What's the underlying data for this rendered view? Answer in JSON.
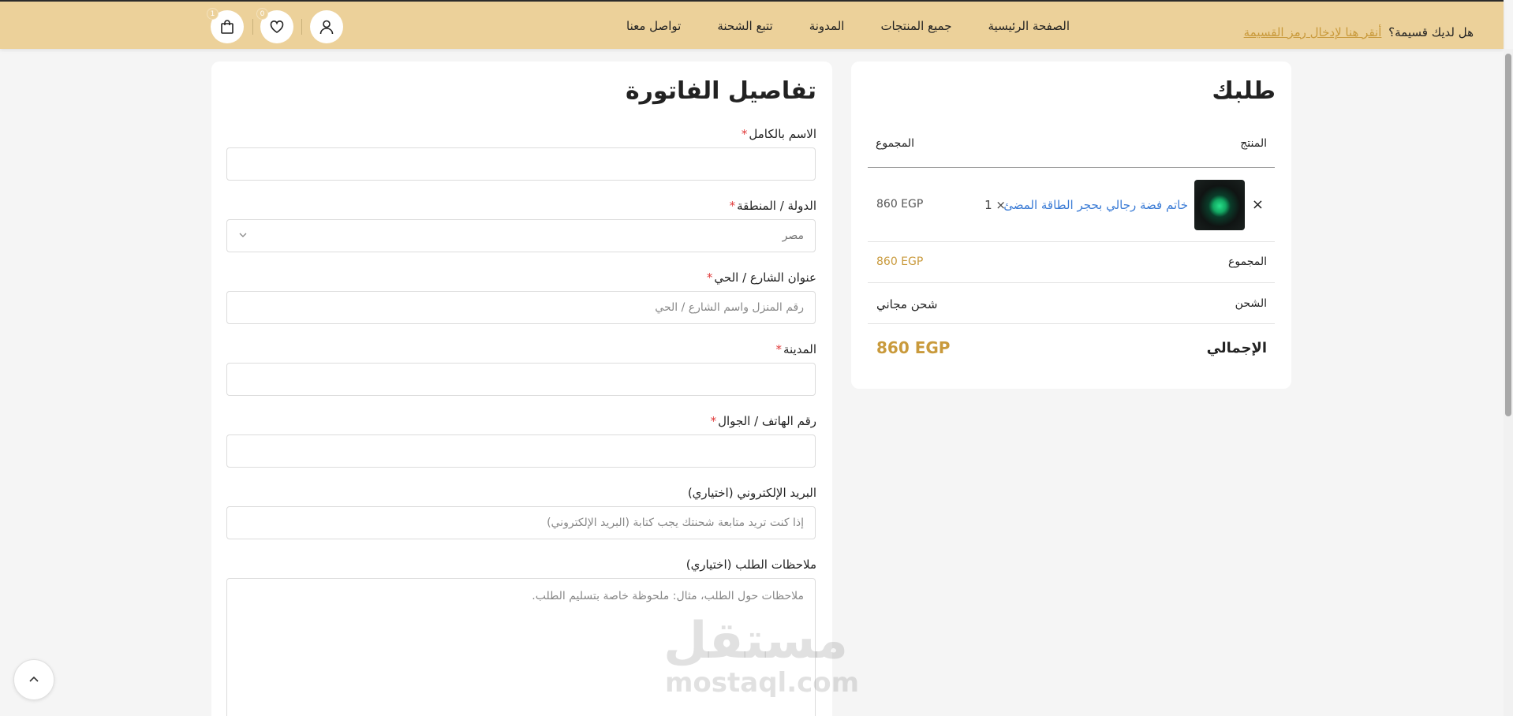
{
  "header": {
    "coupon_question": "هل لديك قسيمة؟",
    "coupon_link": "أنقر هنا لإدخال رمز القسيمة",
    "nav": [
      "الصفحة الرئيسية",
      "جميع المنتجات",
      "المدونة",
      "تتبع الشحنة",
      "تواصل معنا"
    ],
    "cart_count": "1",
    "wishlist_count": "0"
  },
  "order": {
    "title": "طلبك",
    "col_product": "المنتج",
    "col_total": "المجموع",
    "item": {
      "remove": "×",
      "name": "خاتم فضة رجالي بحجر الطاقة المضئ",
      "qty": "× 1",
      "total": "860 EGP"
    },
    "subtotal_label": "المجموع",
    "subtotal_value": "860 EGP",
    "shipping_label": "الشحن",
    "shipping_value": "شحن مجاني",
    "grand_label": "الإجمالي",
    "grand_value": "860 EGP"
  },
  "billing": {
    "title": "تفاصيل الفاتورة",
    "required_mark": "*",
    "full_name_label": "الاسم بالكامل",
    "full_name_value": "",
    "country_label": "الدولة / المنطقة",
    "country_value": "مصر",
    "address_label": "عنوان الشارع / الحي",
    "address_placeholder": "رقم المنزل واسم الشارع / الحي",
    "city_label": "المدينة",
    "city_value": "",
    "phone_label": "رقم الهاتف / الجوال",
    "phone_value": "",
    "email_label": "البريد الإلكتروني (اختياري)",
    "email_placeholder": "إذا كنت تريد متابعة شحنتك يجب كتابة (البريد الإلكتروني)",
    "notes_label": "ملاحظات الطلب (اختياري)",
    "notes_placeholder": "ملاحظات حول الطلب، مثال: ملحوظة خاصة بتسليم الطلب."
  },
  "watermark": {
    "ar": "مستقل",
    "en": "mostaql.com"
  },
  "colors": {
    "header_bg": "#ecd19a",
    "accent_gold": "#c99a3c",
    "link_blue": "#3a7bd5",
    "required_red": "#e03a3a"
  },
  "icons": {
    "account": "user-icon",
    "wishlist": "heart-icon",
    "cart": "shopping-bag-icon",
    "select": "chevron-down-icon",
    "back_to_top": "chevron-up-icon"
  }
}
